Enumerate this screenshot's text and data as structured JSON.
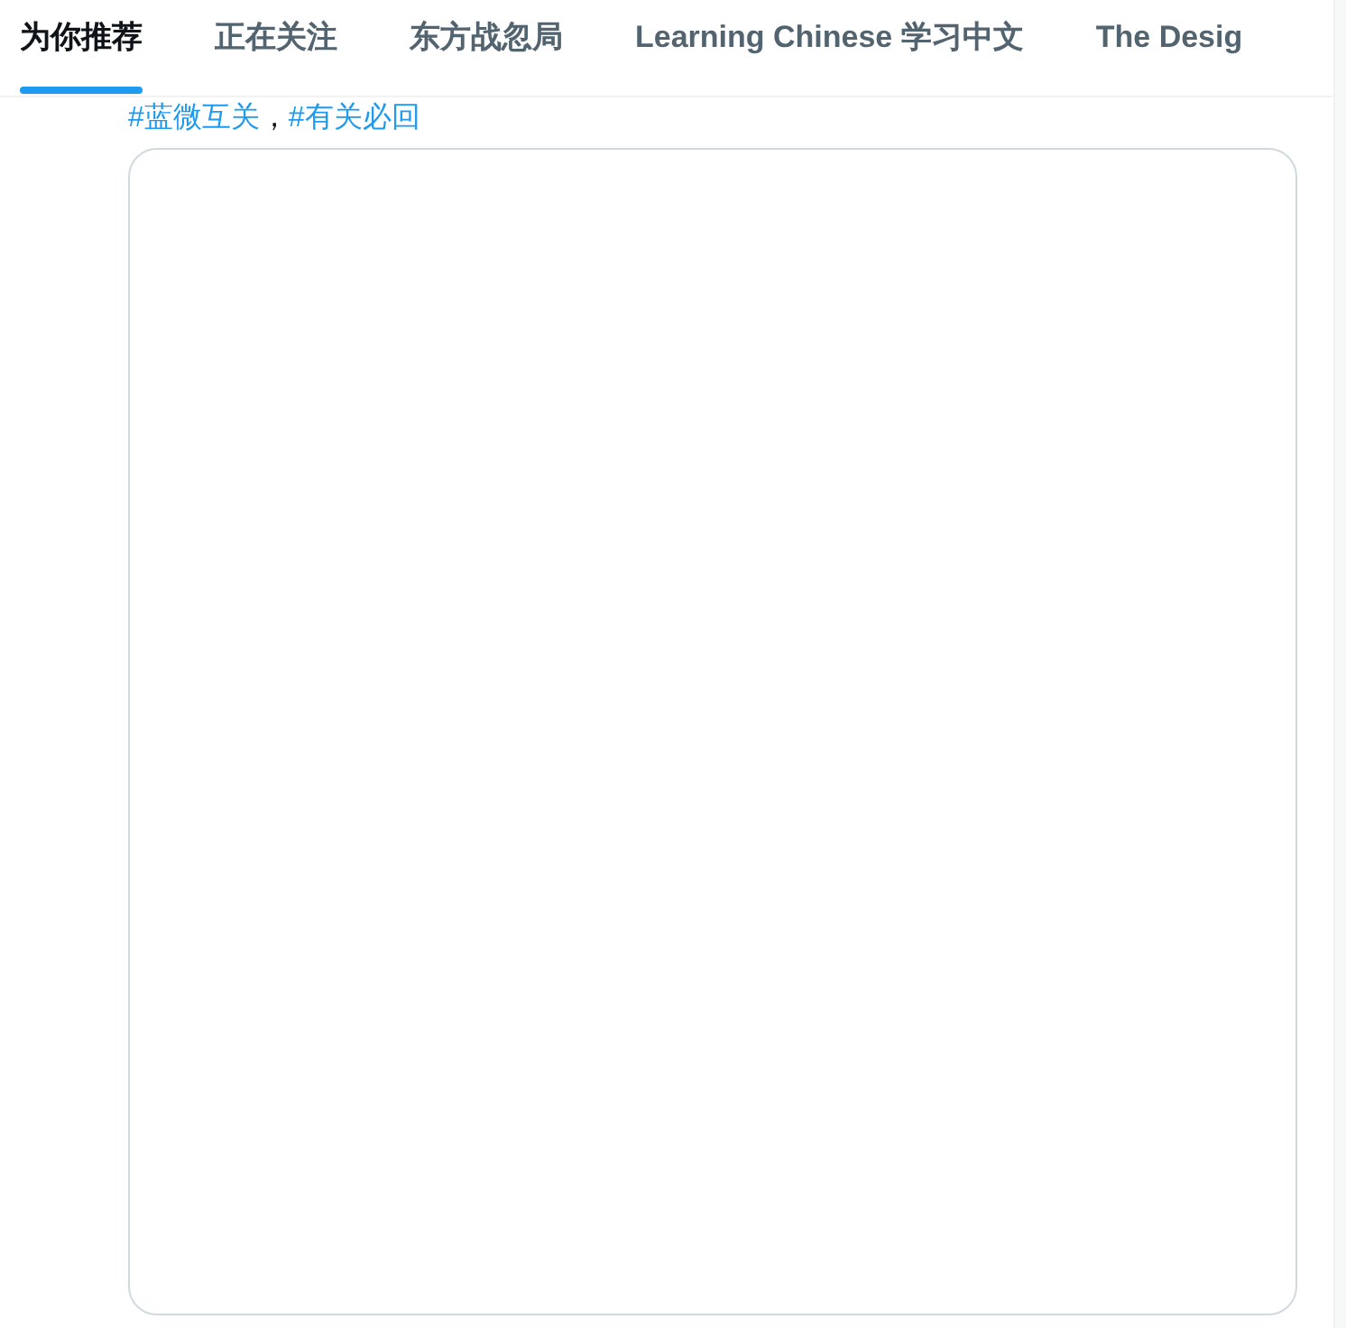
{
  "tabs": [
    {
      "label": "为你推荐",
      "selected": true
    },
    {
      "label": "正在关注",
      "selected": false
    },
    {
      "label": "东方战忽局",
      "selected": false
    },
    {
      "label": "Learning Chinese 学习中文",
      "selected": false
    },
    {
      "label": "The Desig",
      "selected": false
    }
  ],
  "post": {
    "hashtags": [
      "#蓝微互关",
      "#有关必回"
    ],
    "separator": "，"
  }
}
